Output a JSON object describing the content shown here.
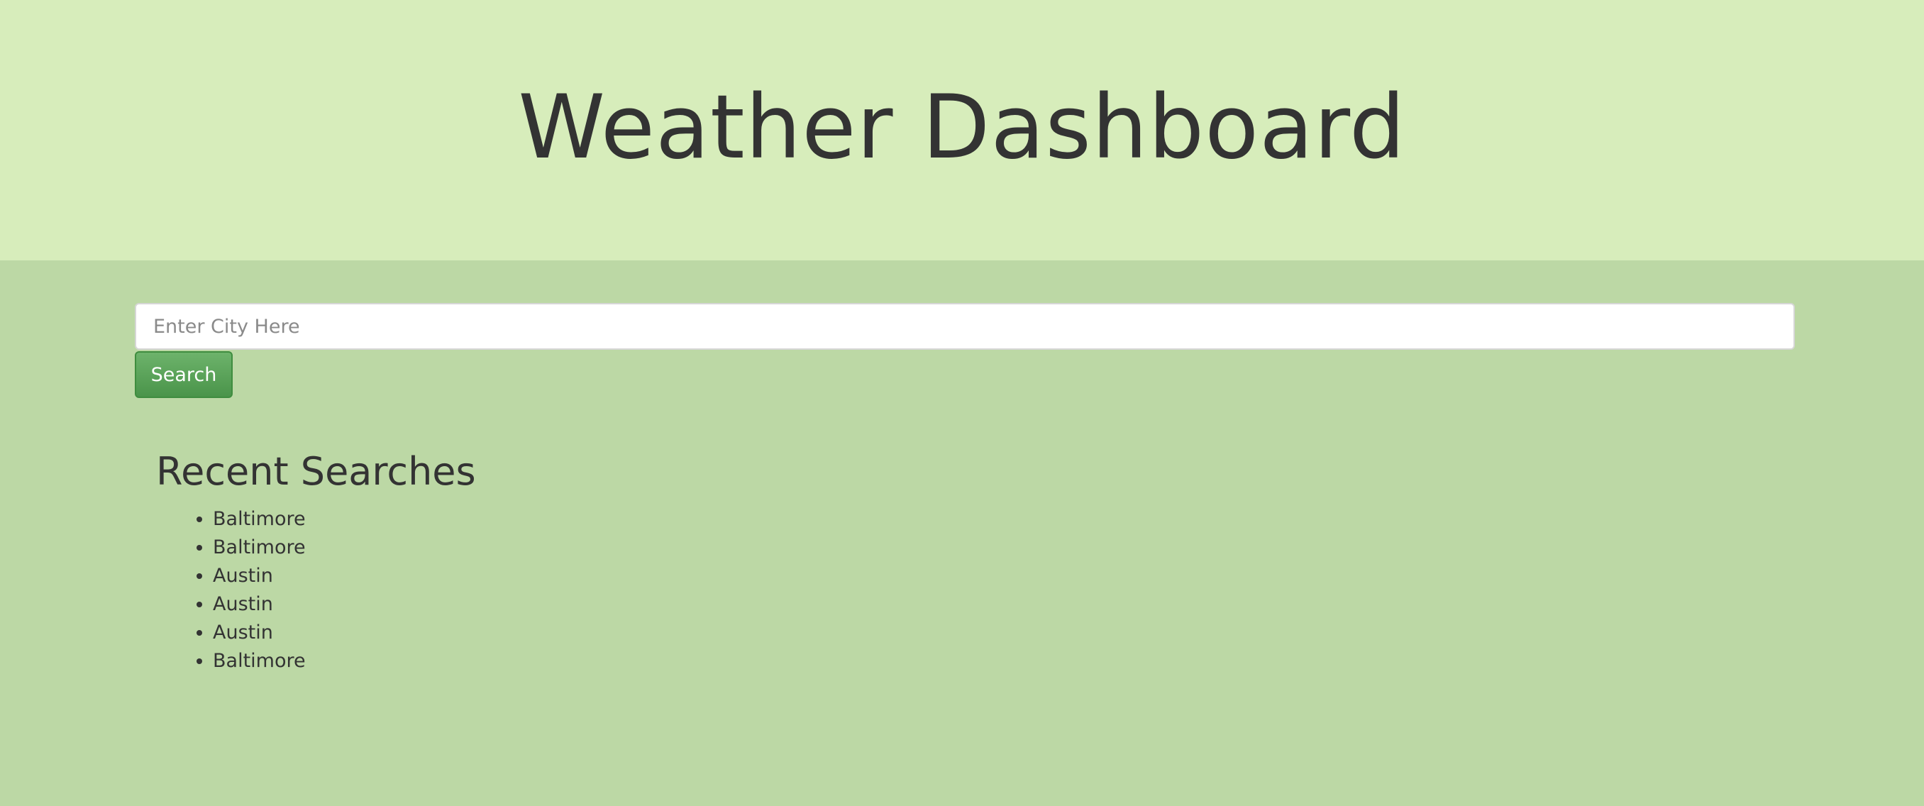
{
  "header": {
    "title": "Weather Dashboard"
  },
  "search": {
    "placeholder": "Enter City Here",
    "value": "",
    "button_label": "Search"
  },
  "recent": {
    "heading": "Recent Searches",
    "items": [
      "Baltimore",
      "Baltimore",
      "Austin",
      "Austin",
      "Austin",
      "Baltimore"
    ]
  },
  "colors": {
    "header_bg": "#d7edbb",
    "page_bg": "#bcd8a5",
    "button_bg": "#5aa458",
    "text": "#333333"
  }
}
